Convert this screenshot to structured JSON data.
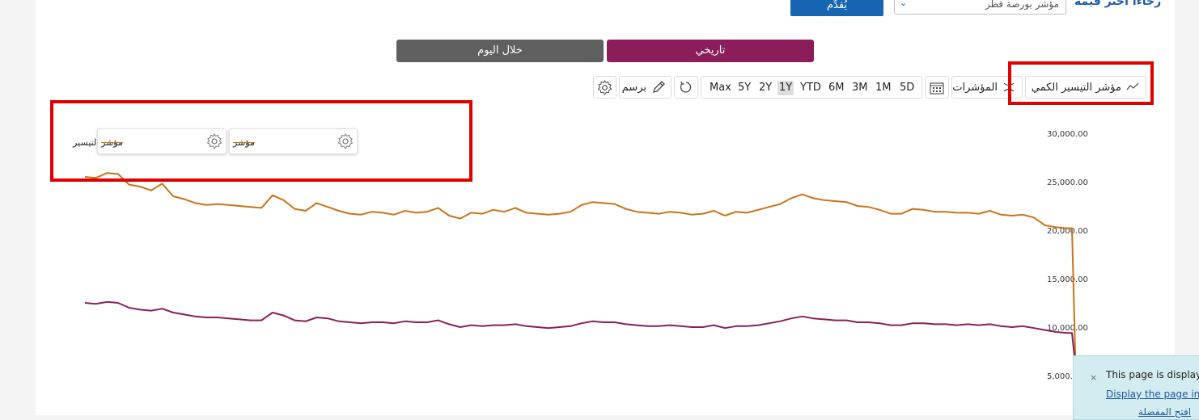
{
  "selector": {
    "prompt": "رجاءاً اختر قيمة",
    "selected_value": "مؤشر بورصة قطر",
    "submit_label": "يُقدِّم"
  },
  "tabs": {
    "historical": "تاريخي",
    "intraday": "خلال اليوم"
  },
  "toolbar": {
    "index_selector_label": "مؤشر التيسير الكمي",
    "indicators_label": "المؤشرات",
    "draw_label": "برسم",
    "ranges": [
      "Max",
      "5Y",
      "2Y",
      "1Y",
      "YTD",
      "6M",
      "3M",
      "1M",
      "5D"
    ],
    "active_range": "1Y"
  },
  "legend": {
    "series_label": "مؤشر التيسير",
    "box1_label": "مؤشر",
    "box2_label": "مؤشر"
  },
  "notice": {
    "message": "This page is display",
    "link": "Display the page in",
    "link2": "افتح المفضلة"
  },
  "chart_data": {
    "type": "line",
    "y_ticks": [
      "30,000.00",
      "25,000.00",
      "20,000.00",
      "15,000.00",
      "10,000.00",
      "5,000.00"
    ],
    "ylim": [
      5000,
      30000
    ],
    "series": [
      {
        "color": "#c9741a",
        "values": [
          25500,
          25400,
          25900,
          25800,
          24700,
          24500,
          24100,
          24800,
          23500,
          23200,
          22800,
          22600,
          22700,
          22600,
          22500,
          22400,
          22300,
          23600,
          23100,
          22200,
          22000,
          22800,
          22400,
          22000,
          21700,
          21600,
          21900,
          21800,
          21600,
          22000,
          21800,
          21900,
          22300,
          21500,
          21200,
          21800,
          21700,
          22100,
          21900,
          22300,
          21800,
          21700,
          21600,
          21700,
          21900,
          22600,
          22900,
          22800,
          22700,
          22200,
          21900,
          21800,
          21700,
          21900,
          21800,
          21600,
          21700,
          22000,
          21500,
          21900,
          21800,
          22100,
          22400,
          22700,
          23300,
          23700,
          23300,
          23100,
          23000,
          22900,
          22500,
          22400,
          22100,
          21700,
          21700,
          22200,
          22100,
          21900,
          21900,
          21800,
          21800,
          21700,
          22000,
          21600,
          21500,
          21600,
          21300,
          20500,
          20300,
          20200
        ]
      },
      {
        "color": "#8b1e5a",
        "values": [
          12500,
          12400,
          12600,
          12500,
          12000,
          11800,
          11700,
          11900,
          11500,
          11300,
          11100,
          11000,
          11000,
          10900,
          10800,
          10700,
          10700,
          11500,
          11200,
          10700,
          10600,
          11000,
          10900,
          10600,
          10500,
          10400,
          10500,
          10500,
          10400,
          10600,
          10500,
          10500,
          10700,
          10300,
          10000,
          10200,
          10100,
          10200,
          10200,
          10300,
          10100,
          10000,
          9900,
          10000,
          10100,
          10400,
          10600,
          10500,
          10500,
          10300,
          10200,
          10100,
          10100,
          10200,
          10100,
          10000,
          10000,
          10200,
          9900,
          10100,
          10100,
          10200,
          10400,
          10600,
          10900,
          11100,
          10900,
          10800,
          10700,
          10700,
          10500,
          10500,
          10400,
          10200,
          10200,
          10400,
          10400,
          10300,
          10300,
          10200,
          10300,
          10200,
          10300,
          10100,
          10000,
          10100,
          9900,
          9700,
          9500,
          9400
        ]
      }
    ]
  }
}
